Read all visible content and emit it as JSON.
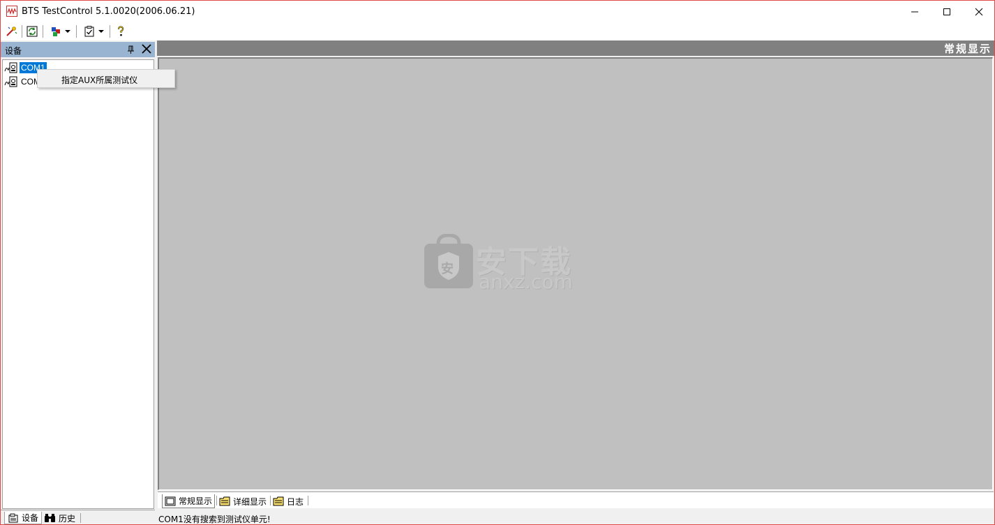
{
  "window": {
    "title": "BTS TestControl 5.1.0020(2006.06.21)",
    "accent_color": "#e04848"
  },
  "toolbar": {
    "buttons": [
      {
        "icon": "wand-icon"
      },
      {
        "icon": "refresh-icon"
      },
      {
        "icon": "aux-tool-icon"
      },
      {
        "icon": "clipboard-check-icon"
      },
      {
        "icon": "help-icon"
      }
    ]
  },
  "left_panel": {
    "title": "设备",
    "tree": [
      {
        "label": "COM1",
        "selected": true
      },
      {
        "label": "COM"
      }
    ],
    "context_menu": {
      "items": [
        "指定AUX所属测试仪"
      ]
    },
    "tabs": [
      {
        "label": "设备",
        "icon": "device-icon",
        "active": true
      },
      {
        "label": "历史",
        "icon": "binoculars-icon",
        "active": false
      }
    ]
  },
  "main": {
    "header_title": "常规显示",
    "watermark": {
      "text_cn": "安下载",
      "text_en": "anxz.com",
      "badge": "安"
    },
    "tabs": [
      {
        "label": "常规显示",
        "icon": "monitor-icon",
        "active": true
      },
      {
        "label": "详细显示",
        "icon": "folder-icon",
        "active": false
      },
      {
        "label": "日志",
        "icon": "folder-icon",
        "active": false
      }
    ]
  },
  "statusbar": {
    "message": "COM1没有搜索到测试仪单元!"
  }
}
